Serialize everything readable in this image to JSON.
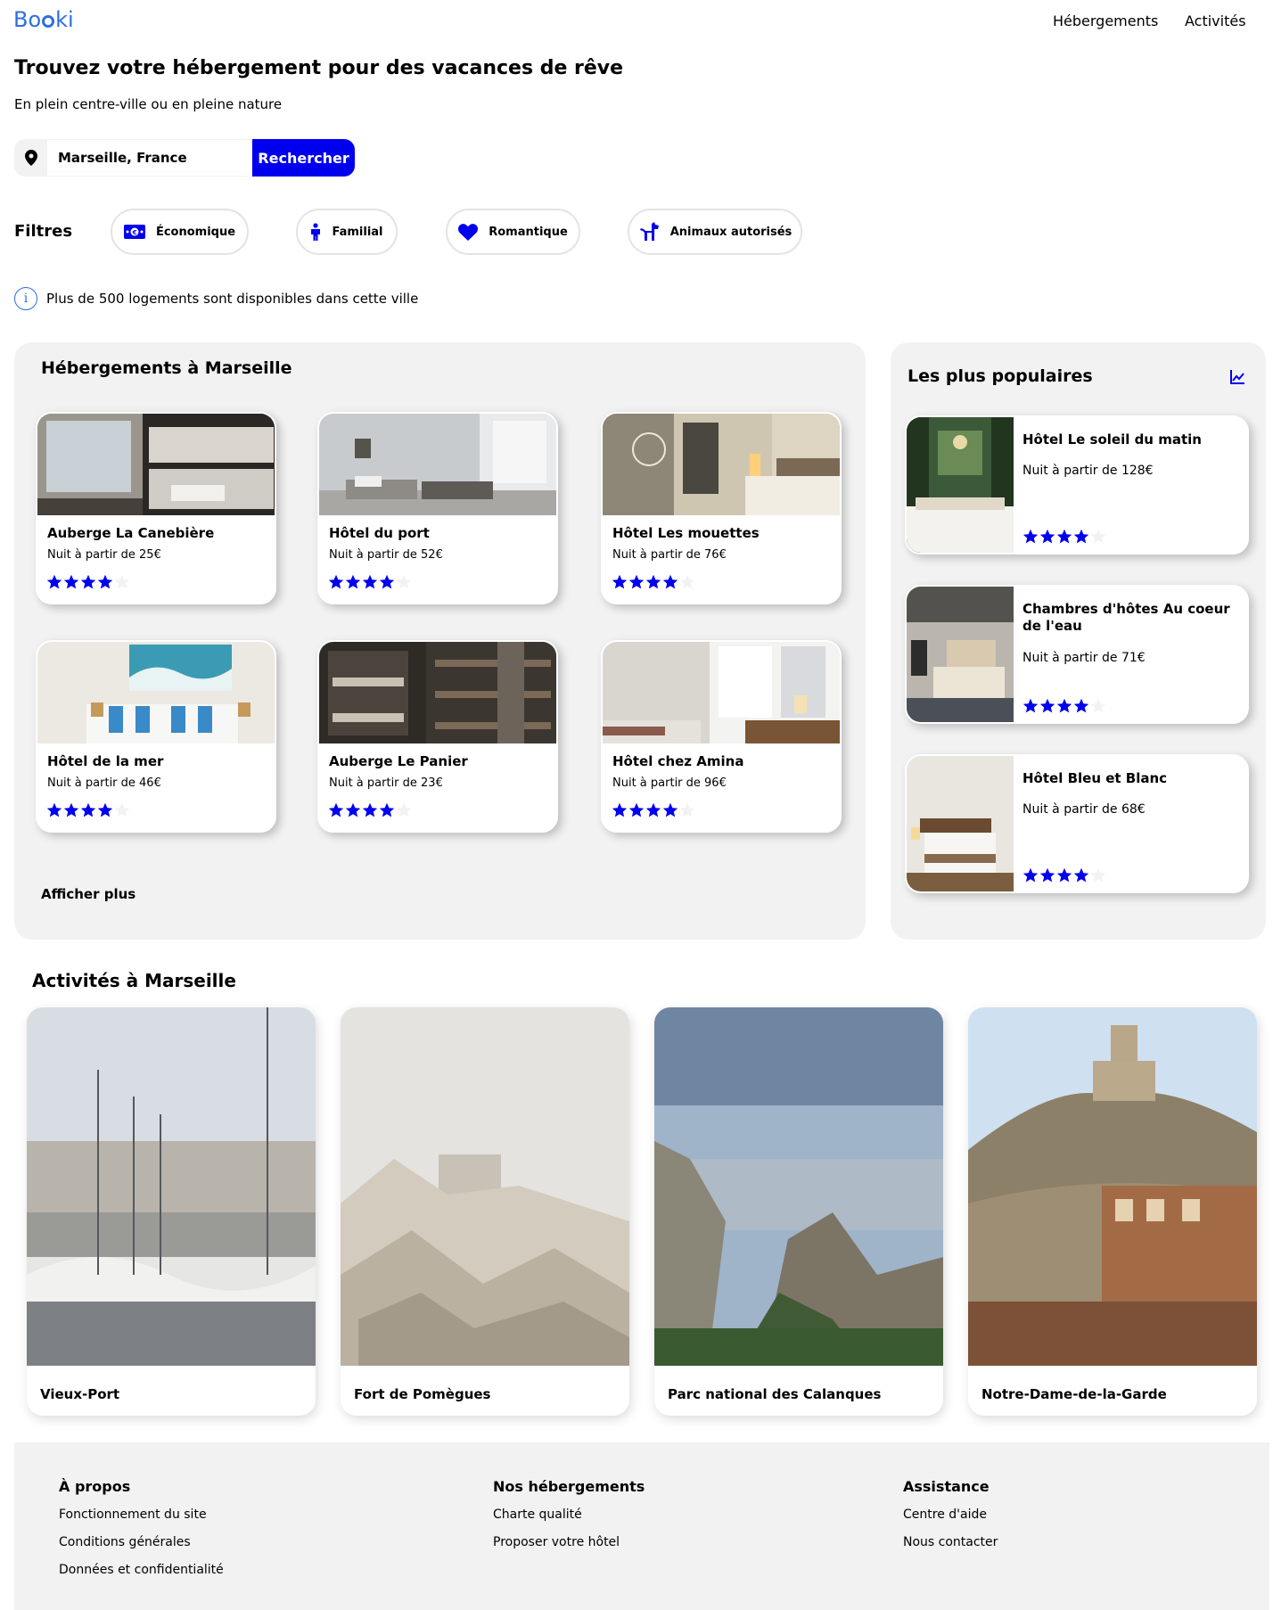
{
  "header": {
    "logo_text_before": "Bo",
    "logo_text_after": "ki",
    "nav": [
      "Hébergements",
      "Activités"
    ]
  },
  "hero": {
    "title": "Trouvez votre hébergement pour des vacances de rêve",
    "subtitle": "En plein centre-ville ou en pleine nature"
  },
  "search": {
    "value": "Marseille, France",
    "icon": "map-pin-icon",
    "button_label": "Rechercher"
  },
  "filters": {
    "label": "Filtres",
    "items": [
      {
        "label": "Économique",
        "icon": "money-icon"
      },
      {
        "label": "Familial",
        "icon": "child-icon"
      },
      {
        "label": "Romantique",
        "icon": "heart-icon"
      },
      {
        "label": "Animaux autorisés",
        "icon": "dog-icon"
      }
    ]
  },
  "info": {
    "icon": "info-icon",
    "text": "Plus de 500 logements sont disponibles dans cette ville"
  },
  "accommodations": {
    "title": "Hébergements à Marseille",
    "show_more": "Afficher plus",
    "items": [
      {
        "name": "Auberge La Canebière",
        "price": "Nuit à partir de 25€",
        "rating": 4
      },
      {
        "name": "Hôtel du port",
        "price": "Nuit à partir de 52€",
        "rating": 4
      },
      {
        "name": "Hôtel Les mouettes",
        "price": "Nuit à partir de 76€",
        "rating": 4
      },
      {
        "name": "Hôtel de la mer",
        "price": "Nuit à partir de 46€",
        "rating": 4
      },
      {
        "name": "Auberge Le Panier",
        "price": "Nuit à partir de 23€",
        "rating": 4
      },
      {
        "name": "Hôtel chez Amina",
        "price": "Nuit à partir de 96€",
        "rating": 4
      }
    ]
  },
  "popular": {
    "title": "Les plus populaires",
    "icon": "trend-chart-icon",
    "items": [
      {
        "name": "Hôtel Le soleil du matin",
        "price": "Nuit à partir de 128€",
        "rating": 4
      },
      {
        "name": "Chambres d'hôtes Au coeur de l'eau",
        "price": "Nuit à partir de 71€",
        "rating": 4
      },
      {
        "name": "Hôtel Bleu et Blanc",
        "price": "Nuit à partir de 68€",
        "rating": 4
      }
    ]
  },
  "activities": {
    "title": "Activités à Marseille",
    "items": [
      "Vieux-Port",
      "Fort de Pomègues",
      "Parc national des Calanques",
      "Notre-Dame-de-la-Garde"
    ]
  },
  "footer": {
    "columns": [
      {
        "title": "À propos",
        "links": [
          "Fonctionnement du site",
          "Conditions générales",
          "Données et confidentialité"
        ]
      },
      {
        "title": "Nos hébergements",
        "links": [
          "Charte qualité",
          "Proposer votre hôtel"
        ]
      },
      {
        "title": "Assistance",
        "links": [
          "Centre d'aide",
          "Nous contacter"
        ]
      }
    ]
  },
  "colors": {
    "brand": "#2d6fe0",
    "accent": "#0000ee",
    "panel": "#f2f2f2",
    "star_empty": "#f2f2f2"
  }
}
